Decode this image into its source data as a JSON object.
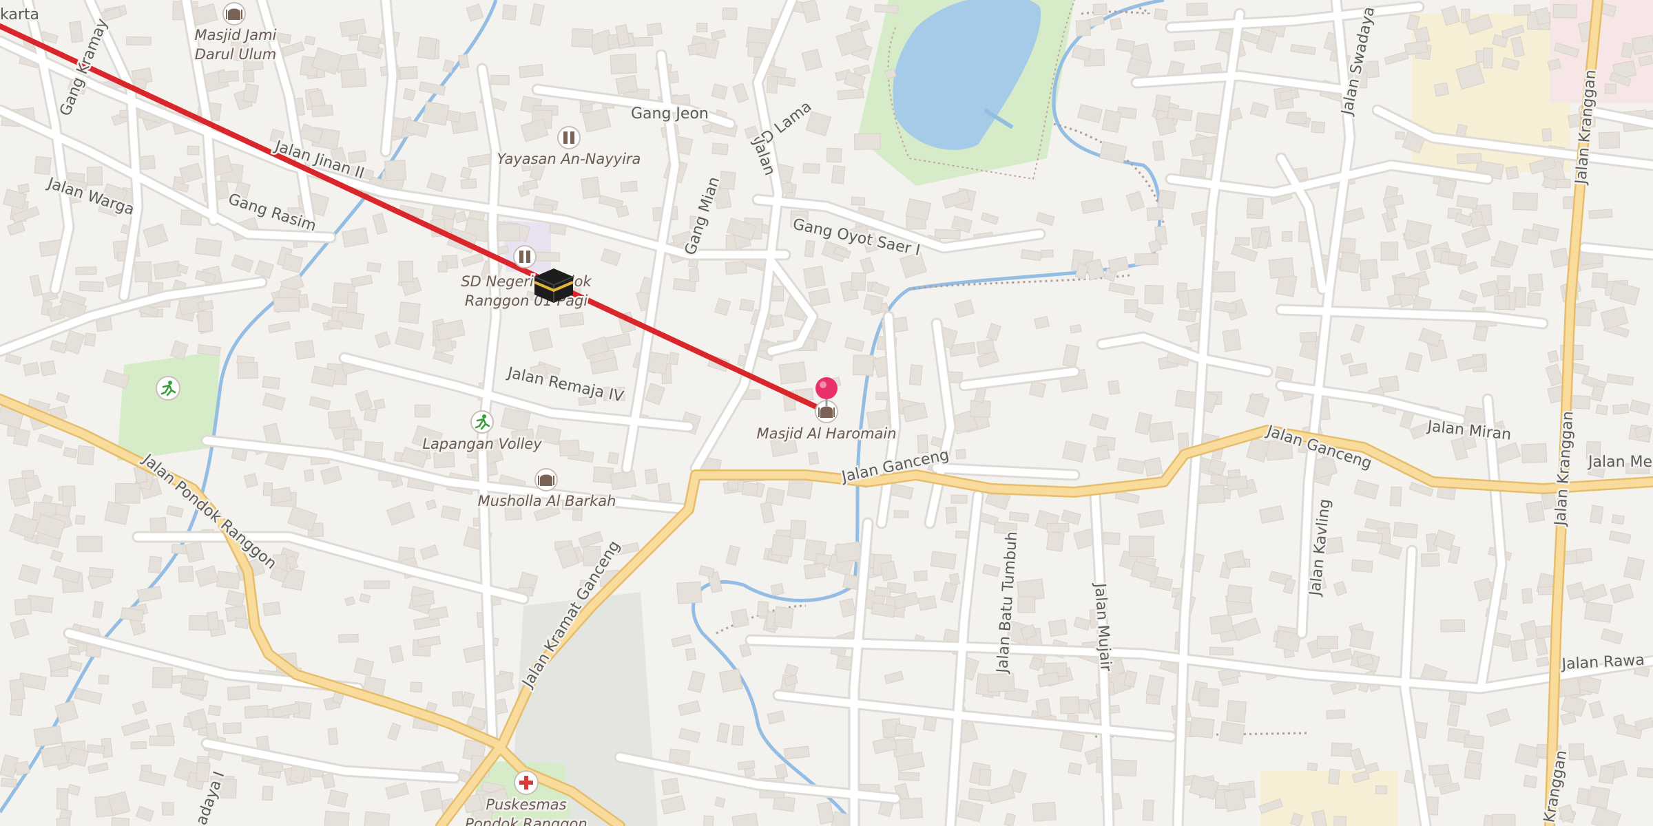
{
  "map": {
    "colors": {
      "background": "#f4f2ef",
      "minor_road": "#ffffff",
      "road_casing": "#dedbd6",
      "major_road": "#f9dc9c",
      "major_road_casing": "#e6bd6a",
      "water": "#a6cbe8",
      "river": "#93bde3",
      "park": "#d6ecc9",
      "building": "#e6e0da",
      "route_line": "#d9262b",
      "pin": "#e8306b",
      "hospital_red": "#d83a3a"
    },
    "streets": [
      {
        "id": "gang-kramay",
        "name": "Gang Kramay"
      },
      {
        "id": "jalan-jinan-ii",
        "name": "Jalan Jinan II"
      },
      {
        "id": "jalan-warga",
        "name": "Jalan Warga"
      },
      {
        "id": "gang-rasim",
        "name": "Gang Rasim"
      },
      {
        "id": "gang-jeon",
        "name": "Gang Jeon"
      },
      {
        "id": "sd-lama",
        "name": "SD Lama"
      },
      {
        "id": "jalan-sd",
        "name": "Jalan"
      },
      {
        "id": "gang-mian",
        "name": "Gang Mian"
      },
      {
        "id": "gang-oyot-saer-i",
        "name": "Gang Oyot Saer I"
      },
      {
        "id": "jalan-swadaya",
        "name": "Jalan Swadaya"
      },
      {
        "id": "jalan-kranggan-n",
        "name": "Jalan Kranggan"
      },
      {
        "id": "jalan-remaja-iv",
        "name": "Jalan Remaja IV"
      },
      {
        "id": "jalan-ganceng-w",
        "name": "Jalan Ganceng"
      },
      {
        "id": "jalan-ganceng-e",
        "name": "Jalan Ganceng"
      },
      {
        "id": "jalan-miran",
        "name": "Jalan Miran"
      },
      {
        "id": "jalan-me",
        "name": "Jalan Me"
      },
      {
        "id": "jalan-pondok-ranggon",
        "name": "Jalan Pondok Ranggon"
      },
      {
        "id": "jalan-kramat-ganceng",
        "name": "Jalan Kramat Ganceng"
      },
      {
        "id": "jalan-batu-tumbuh",
        "name": "Jalan Batu Tumbuh"
      },
      {
        "id": "jalan-mujair",
        "name": "Jalan Mujair"
      },
      {
        "id": "jalan-kavling",
        "name": "Jalan Kavling"
      },
      {
        "id": "jalan-kranggan-s",
        "name": "Jalan Kranggan"
      },
      {
        "id": "jalan-rawa",
        "name": "Jalan Rawa"
      },
      {
        "id": "kranggan-s",
        "name": "Kranggan"
      },
      {
        "id": "swadaya-i",
        "name": "adaya I"
      },
      {
        "id": "karta",
        "name": "karta"
      }
    ],
    "pois": [
      {
        "id": "masjid-jami-darul-ulum",
        "lines": [
          "Masjid Jami",
          "Darul Ulum"
        ],
        "icon": "mosque-icon"
      },
      {
        "id": "yayasan-an-nayyira",
        "lines": [
          "Yayasan An-Nayyira"
        ],
        "icon": "school-icon"
      },
      {
        "id": "sd-negeri",
        "lines": [
          "SD Negeri Pondok",
          "Ranggon 01 Pagi"
        ],
        "icon": "school-icon"
      },
      {
        "id": "lapangan-volley",
        "lines": [
          "Lapangan Volley"
        ],
        "icon": "sports-icon"
      },
      {
        "id": "musholla-al-barkah",
        "lines": [
          "Musholla Al Barkah"
        ],
        "icon": "mosque-icon"
      },
      {
        "id": "masjid-al-haromain",
        "lines": [
          "Masjid Al Haromain"
        ],
        "icon": "mosque-icon"
      },
      {
        "id": "puskesmas",
        "lines": [
          "Puskesmas",
          "Pondok Ranggon"
        ],
        "icon": "hospital-icon"
      },
      {
        "id": "park-sport",
        "lines": [],
        "icon": "sports-icon"
      }
    ],
    "markers": {
      "kaaba": "kaaba-icon",
      "location_pin": "location-pin-icon"
    }
  }
}
